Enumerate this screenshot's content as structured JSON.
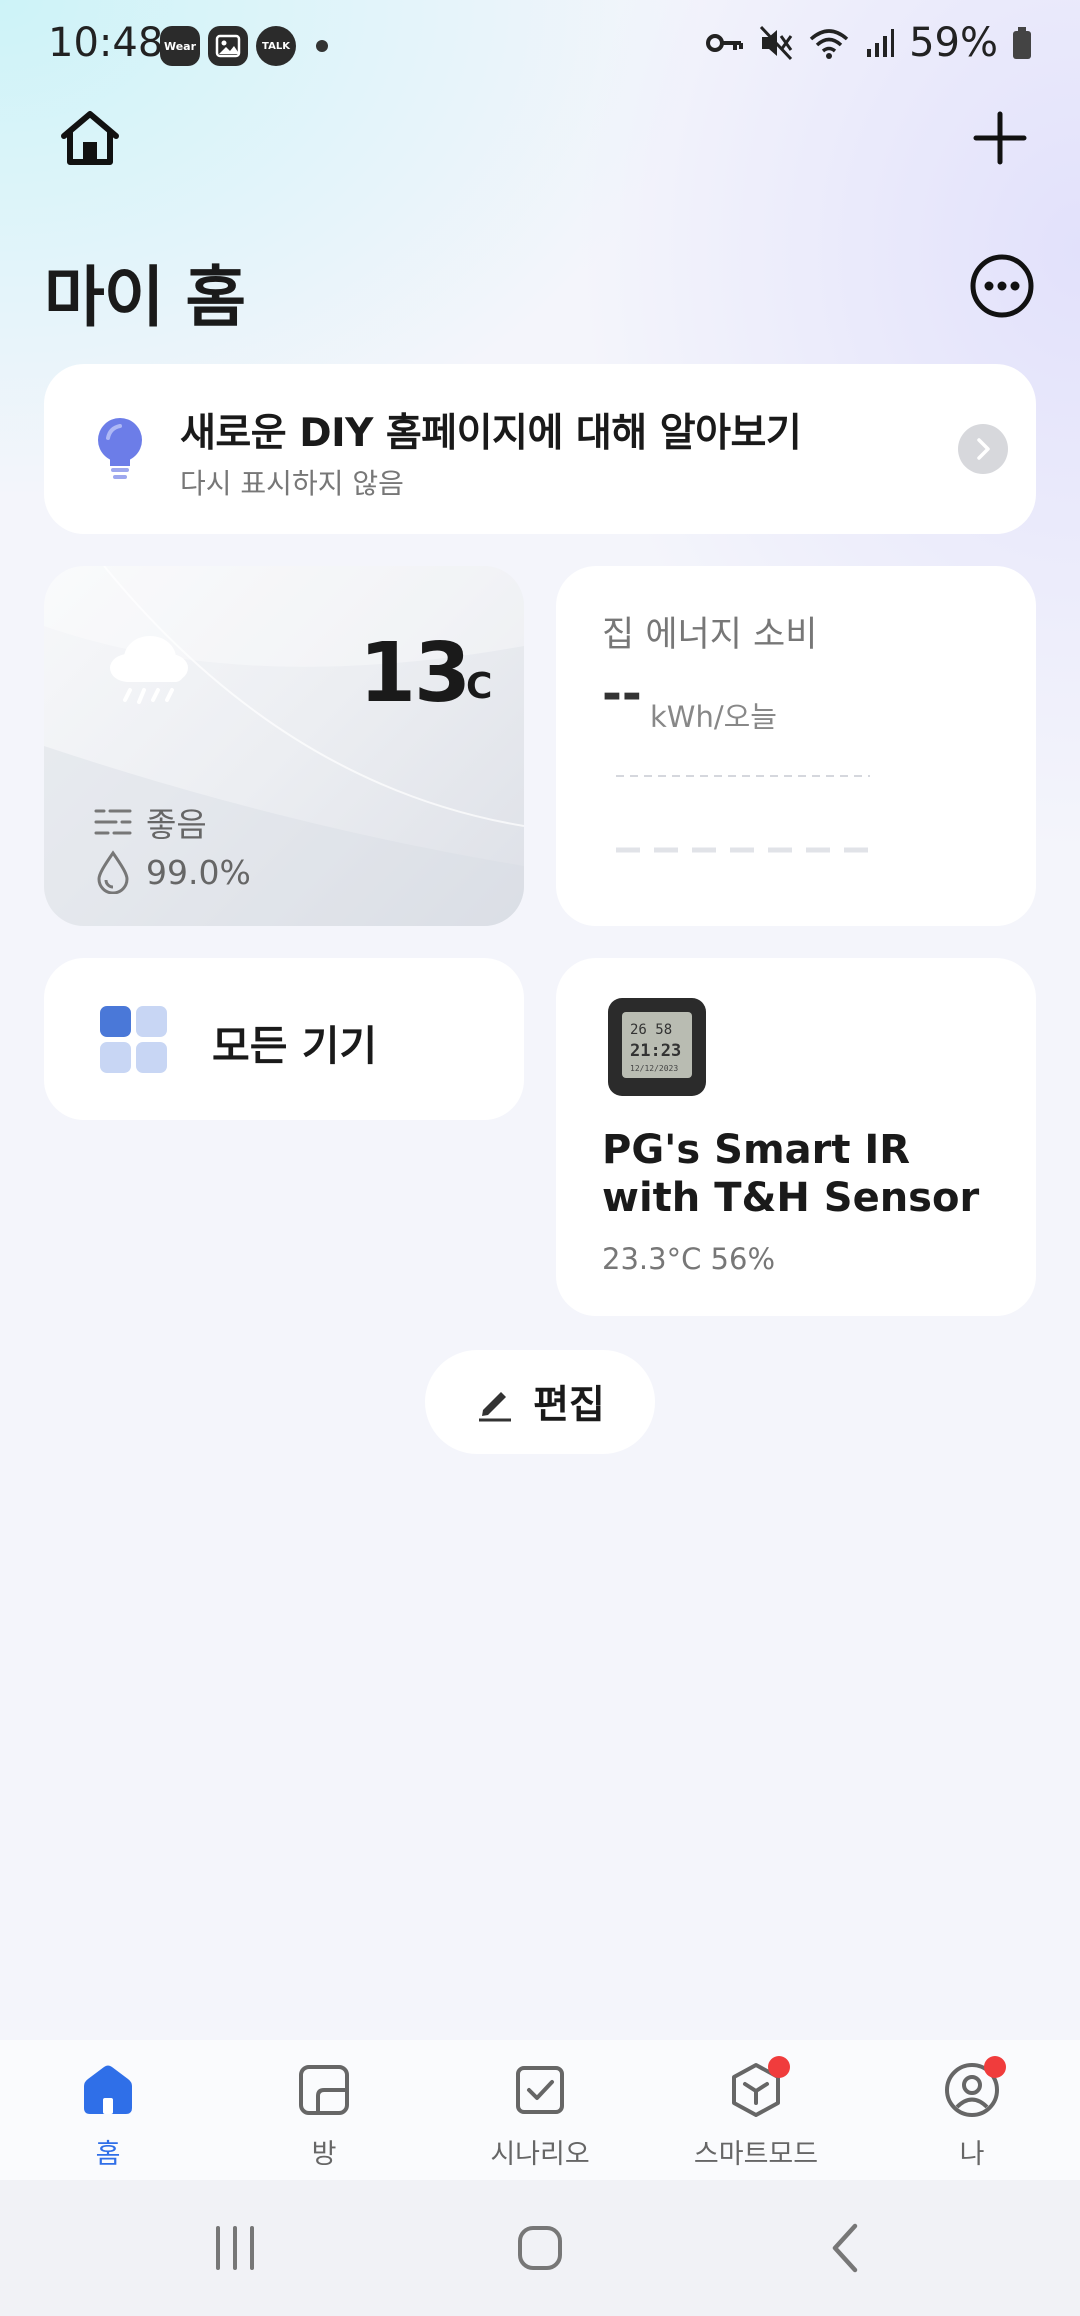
{
  "status_bar": {
    "time": "10:48",
    "apps": [
      "Wear",
      "Gallery",
      "TALK"
    ],
    "battery": "59%"
  },
  "page_title": "마이 홈",
  "banner": {
    "title": "새로운 DIY 홈페이지에 대해 알아보기",
    "subtitle": "다시 표시하지 않음"
  },
  "weather": {
    "temperature": "13",
    "unit": "°C",
    "air_quality": "좋음",
    "humidity": "99.0%"
  },
  "energy": {
    "title": "집 에너지 소비",
    "value": "--",
    "unit": "kWh/오늘"
  },
  "all_devices": {
    "label": "모든 기기"
  },
  "device": {
    "name": "PG's Smart IR with T&H Sensor",
    "status": "23.3°C  56%"
  },
  "edit_button": {
    "label": "편집"
  },
  "tabs": [
    {
      "label": "홈",
      "active": true
    },
    {
      "label": "방",
      "active": false
    },
    {
      "label": "시나리오",
      "active": false
    },
    {
      "label": "스마트모드",
      "active": false,
      "badge": true
    },
    {
      "label": "나",
      "active": false,
      "badge": true
    }
  ],
  "colors": {
    "accent": "#2f6fe8",
    "badge": "#f03c3c",
    "background": "#f4f5fb"
  }
}
